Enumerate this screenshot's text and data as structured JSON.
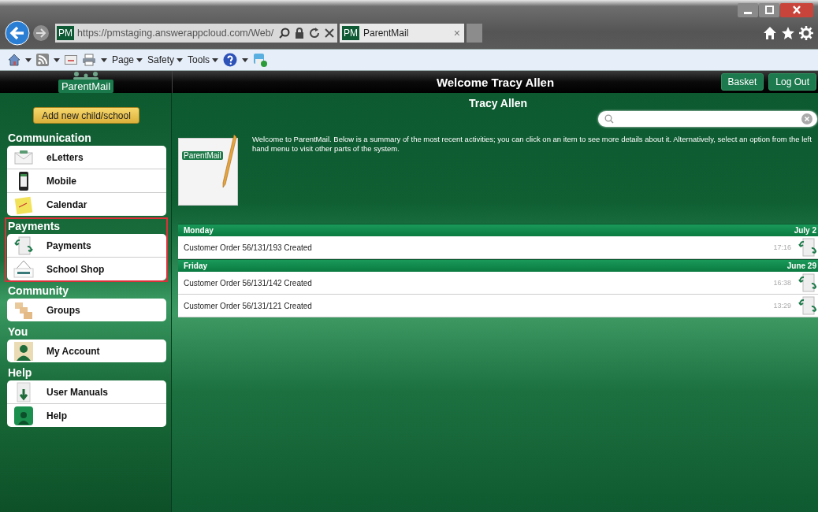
{
  "browser": {
    "address": "https://pmstaging.answerappcloud.com/Web/",
    "tab": {
      "favicon": "PM",
      "title": "ParentMail",
      "close": "×",
      "selected": true
    },
    "address_favicon": "PM",
    "commands": [
      "Page",
      "Safety",
      "Tools"
    ]
  },
  "header": {
    "logo": "ParentMail",
    "title": "Welcome Tracy Allen",
    "buttons": [
      "Basket",
      "Log Out"
    ]
  },
  "sidebar": {
    "add_button": "Add new child/school",
    "sections": [
      {
        "title": "Communication",
        "highlighted": false,
        "items": [
          {
            "label": "eLetters",
            "kind": "envelope"
          },
          {
            "label": "Mobile",
            "kind": "phone"
          },
          {
            "label": "Calendar",
            "kind": "note"
          }
        ]
      },
      {
        "title": "Payments",
        "highlighted": true,
        "items": [
          {
            "label": "Payments",
            "kind": "receipt"
          },
          {
            "label": "School Shop",
            "kind": "sign"
          }
        ]
      },
      {
        "title": "Community",
        "highlighted": false,
        "items": [
          {
            "label": "Groups",
            "kind": "cards"
          }
        ]
      },
      {
        "title": "You",
        "highlighted": false,
        "items": [
          {
            "label": "My Account",
            "kind": "person"
          }
        ]
      },
      {
        "title": "Help",
        "highlighted": false,
        "items": [
          {
            "label": "User Manuals",
            "kind": "manual"
          },
          {
            "label": "Help",
            "kind": "app"
          }
        ]
      }
    ]
  },
  "main": {
    "user": "Tracy Allen",
    "logo_text": "ParentMail",
    "welcome": "Welcome to ParentMail. Below is a summary of the most recent activities; you can click on an item to see more details about it. Alternatively, select an option from the left hand menu to visit other parts of the system.",
    "days": [
      {
        "day": "Monday",
        "date": "July 2",
        "entries": [
          {
            "text": "Customer Order 56/131/193 Created",
            "time": "17:16"
          }
        ]
      },
      {
        "day": "Friday",
        "date": "June 29",
        "entries": [
          {
            "text": "Customer Order 56/131/142 Created",
            "time": "16:38"
          },
          {
            "text": "Customer Order 56/131/121 Created",
            "time": "13:29"
          }
        ]
      }
    ]
  }
}
